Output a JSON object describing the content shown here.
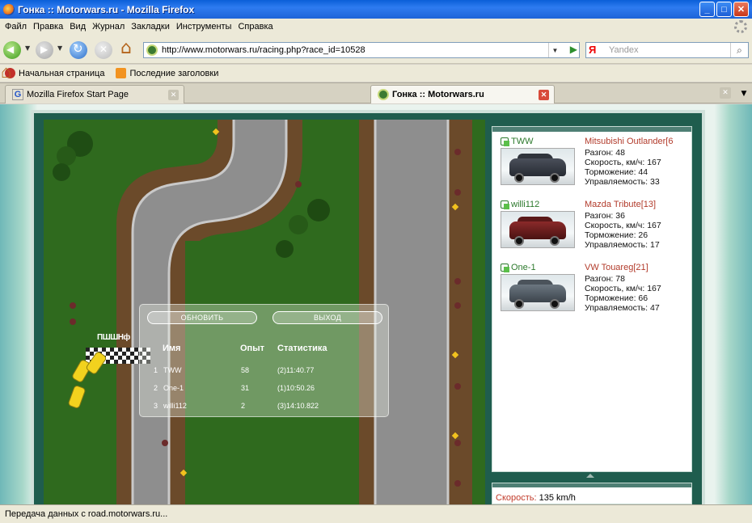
{
  "window": {
    "title": "Гонка :: Motorwars.ru - Mozilla Firefox",
    "min": "_",
    "max": "□",
    "close": "✕"
  },
  "menu": [
    "Файл",
    "Правка",
    "Вид",
    "Журнал",
    "Закладки",
    "Инструменты",
    "Справка"
  ],
  "nav": {
    "url": "http://www.motorwars.ru/racing.php?race_id=10528",
    "search_engine": "Я",
    "search_placeholder": "Yandex"
  },
  "bookmarks": [
    {
      "label": "Начальная страница",
      "icon": "home-icon"
    },
    {
      "label": "Последние заголовки",
      "icon": "rss-icon"
    }
  ],
  "tabs": [
    {
      "label": "Mozilla Firefox Start Page",
      "favicon": "G",
      "active": false
    },
    {
      "label": "Гонка :: Motorwars.ru",
      "favicon": "",
      "active": true
    }
  ],
  "race": {
    "refresh_button": "ОБНОВИТЬ",
    "exit_button": "ВЫХОД",
    "start_label": "ПШШНф",
    "headers": {
      "name": "Имя",
      "exp": "Опыт",
      "stats": "Статистика"
    },
    "rows": [
      {
        "rank": "1",
        "name": "TWW",
        "exp": "58",
        "stats": "(2)11:40.77"
      },
      {
        "rank": "2",
        "name": "One-1",
        "exp": "31",
        "stats": "(1)10:50.26"
      },
      {
        "rank": "3",
        "name": "willi112",
        "exp": "2",
        "stats": "(3)14:10.822"
      }
    ]
  },
  "players": [
    {
      "name": "TWW",
      "car": "Mitsubishi Outlander[6",
      "car_color": "dark",
      "accel": "Разгон: 48",
      "speed": "Скорость, км/ч: 167",
      "brake": "Торможение: 44",
      "handling": "Управляемость: 33"
    },
    {
      "name": "willi112",
      "car": "Mazda Tribute[13]",
      "car_color": "red",
      "accel": "Разгон: 36",
      "speed": "Скорость, км/ч: 167",
      "brake": "Торможение: 26",
      "handling": "Управляемость: 17"
    },
    {
      "name": "One-1",
      "car": "VW Touareg[21]",
      "car_color": "gray",
      "accel": "Разгон: 78",
      "speed": "Скорость, км/ч: 167",
      "brake": "Торможение: 66",
      "handling": "Управляемость: 47"
    }
  ],
  "speed": {
    "label": "Скорость:",
    "value": "135 km/h"
  },
  "status": "Передача данных с road.motorwars.ru..."
}
